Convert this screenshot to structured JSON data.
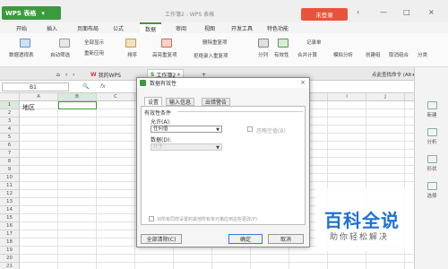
{
  "app": {
    "name": "WPS 表格",
    "doc_title": "工作簿2 - WPS 表格",
    "login_label": "未登录"
  },
  "window_controls": [
    "‹",
    "—",
    "□",
    "×"
  ],
  "menu": [
    "开始",
    "插入",
    "页面布局",
    "公式",
    "数据",
    "审阅",
    "视图",
    "开发工具",
    "特色功能"
  ],
  "menu_active_index": 4,
  "ribbon": {
    "pivot": "数据透视表",
    "autofilter": "自动筛选",
    "show_all": "全部显示",
    "reapply": "重新应用",
    "sort": "排序",
    "highlight_dup": "高亮重复项",
    "delete_dup": "删除重复项",
    "reject_dup": "拒绝录入重复项",
    "split": "分列",
    "validity": "有效性",
    "merge_calc": "合并计算",
    "record": "记录单",
    "simulate": "模拟分析",
    "create_group": "创建组",
    "ungroup": "取消组合",
    "subtotal": "分类",
    "top_right": "点此查找命令 (Alt+Q)"
  },
  "tabs": [
    {
      "label": "我的WPS"
    },
    {
      "label": "工作簿2 *"
    }
  ],
  "tab_add": "+",
  "formula": {
    "namebox": "B1",
    "fx": "fx"
  },
  "columns": [
    "A",
    "B",
    "C",
    "D",
    "E",
    "F",
    "G",
    "H",
    "I",
    "J",
    "K"
  ],
  "rows": [
    "1",
    "2",
    "3",
    "4",
    "5",
    "6",
    "7",
    "8",
    "9",
    "10",
    "11",
    "12",
    "13",
    "14",
    "15",
    "16",
    "17",
    "18",
    "19",
    "20",
    "21",
    "22"
  ],
  "cell_a1": "地区",
  "right_panel": [
    "新建",
    "分析",
    "形状",
    "选择"
  ],
  "dialog": {
    "title": "数据有效性",
    "tabs": [
      "设置",
      "输入信息",
      "出错警告"
    ],
    "criteria_label": "有效性条件",
    "allow_label": "允许(A):",
    "allow_value": "任何值",
    "ignore_blank": "忽略空值(B)",
    "data_label": "数据(D):",
    "data_value": "介于",
    "apply_all": "对所有同样设置的其他所有单元格应用这些更改(P)",
    "clear_all": "全部清除(C)",
    "ok": "确定",
    "cancel": "取消"
  },
  "watermark": {
    "title": "百科全说",
    "subtitle": "助你轻松解决"
  }
}
